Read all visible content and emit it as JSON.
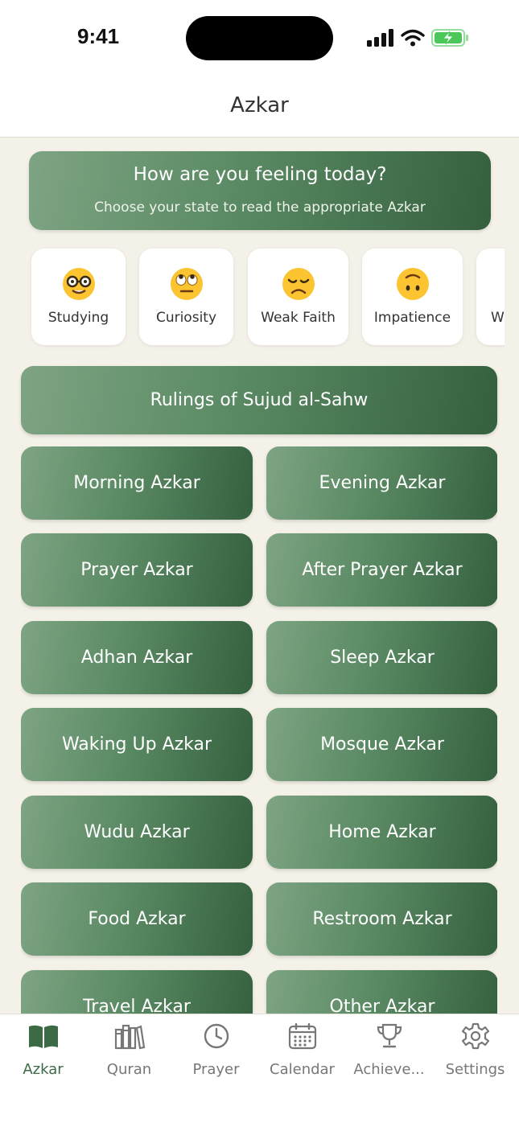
{
  "status": {
    "time": "9:41"
  },
  "header": {
    "title": "Azkar"
  },
  "banner": {
    "title": "How are you feeling today?",
    "subtitle": "Choose your state to read the appropriate Azkar"
  },
  "moods": [
    {
      "label": "Studying",
      "emoji": "🤓",
      "icon": "nerd-face-icon"
    },
    {
      "label": "Curiosity",
      "emoji": "🙄",
      "icon": "eye-roll-face-icon"
    },
    {
      "label": "Weak Faith",
      "emoji": "😞",
      "icon": "disappointed-face-icon"
    },
    {
      "label": "Impatience",
      "emoji": "🙃",
      "icon": "upside-down-face-icon"
    },
    {
      "label": "W",
      "emoji": "",
      "icon": ""
    }
  ],
  "rulings_button": "Rulings of Sujud al-Sahw",
  "azkar": [
    "Morning Azkar",
    "Evening Azkar",
    "Prayer Azkar",
    "After Prayer Azkar",
    "Adhan Azkar",
    "Sleep Azkar",
    "Waking Up Azkar",
    "Mosque Azkar",
    "Wudu Azkar",
    "Home Azkar",
    "Food Azkar",
    "Restroom Azkar",
    "Travel Azkar",
    "Other Azkar"
  ],
  "tabs": [
    {
      "label": "Azkar",
      "icon": "open-book-icon",
      "active": true
    },
    {
      "label": "Quran",
      "icon": "books-icon",
      "active": false
    },
    {
      "label": "Prayer",
      "icon": "clock-icon",
      "active": false
    },
    {
      "label": "Calendar",
      "icon": "calendar-icon",
      "active": false
    },
    {
      "label": "Achieve...",
      "icon": "trophy-icon",
      "active": false
    },
    {
      "label": "Settings",
      "icon": "gear-icon",
      "active": false
    }
  ],
  "colors": {
    "accent": "#3b6a45",
    "background": "#f4f2e8",
    "battery": "#4cc85a"
  }
}
